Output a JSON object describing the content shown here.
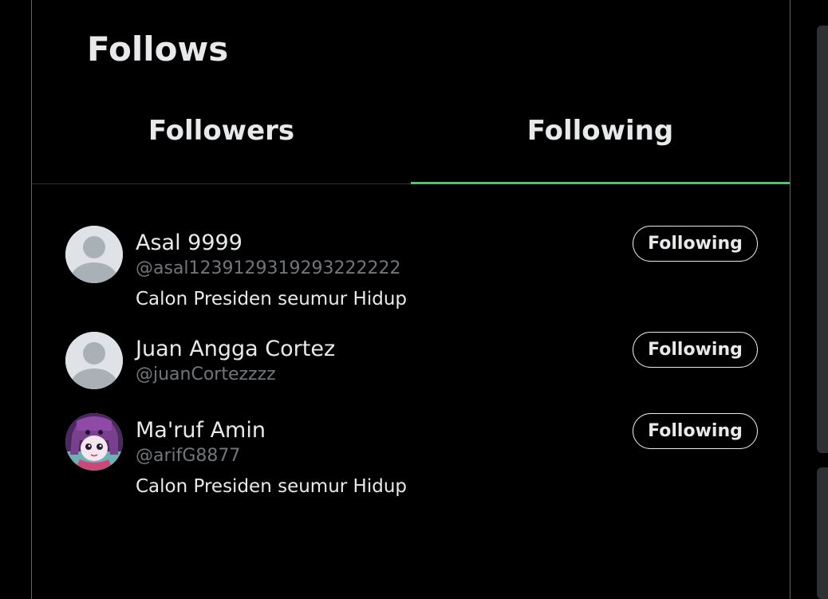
{
  "page": {
    "title": "Follows"
  },
  "tabs": [
    {
      "label": "Followers",
      "active": false
    },
    {
      "label": "Following",
      "active": true
    }
  ],
  "colors": {
    "accent": "#5bbd73",
    "background": "#000000",
    "text": "#e7e9ea",
    "muted": "#71767b"
  },
  "users": [
    {
      "name": "Asal 9999",
      "handle": "@asal1239129319293222222",
      "bio": "Calon Presiden seumur Hidup",
      "button_label": "Following",
      "avatar": "default-avatar-icon"
    },
    {
      "name": "Juan Angga Cortez",
      "handle": "@juanCortezzzz",
      "bio": "",
      "button_label": "Following",
      "avatar": "default-avatar-icon"
    },
    {
      "name": "Ma'ruf Amin",
      "handle": "@arifG8877",
      "bio": "Calon Presiden seumur Hidup",
      "button_label": "Following",
      "avatar": "anime-character-avatar"
    }
  ]
}
